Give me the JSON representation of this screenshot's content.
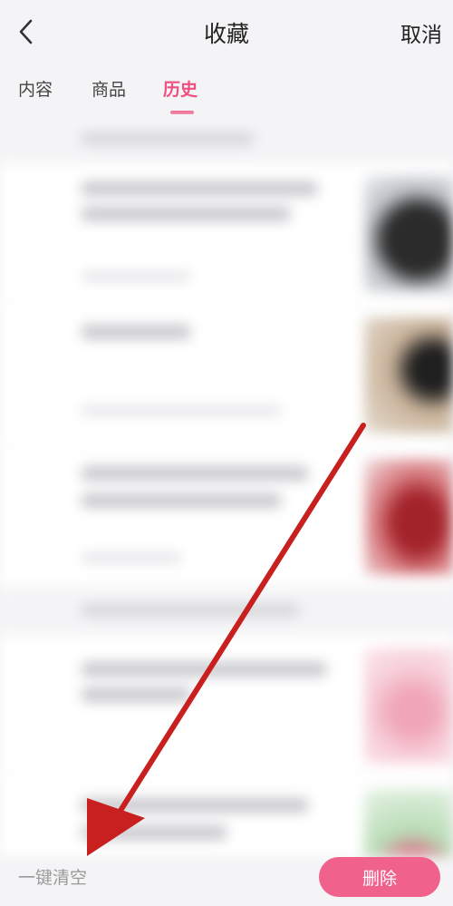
{
  "header": {
    "title": "收藏",
    "cancel_label": "取消",
    "back_icon": "chevron-left-icon"
  },
  "tabs": [
    {
      "label": "内容",
      "active": false
    },
    {
      "label": "商品",
      "active": false
    },
    {
      "label": "历史",
      "active": true
    }
  ],
  "colors": {
    "accent": "#ef4f7f",
    "delete_button": "#f0628c",
    "arrow": "#c8201e"
  },
  "bottom_bar": {
    "clear_all_label": "一键清空",
    "delete_label": "删除"
  }
}
